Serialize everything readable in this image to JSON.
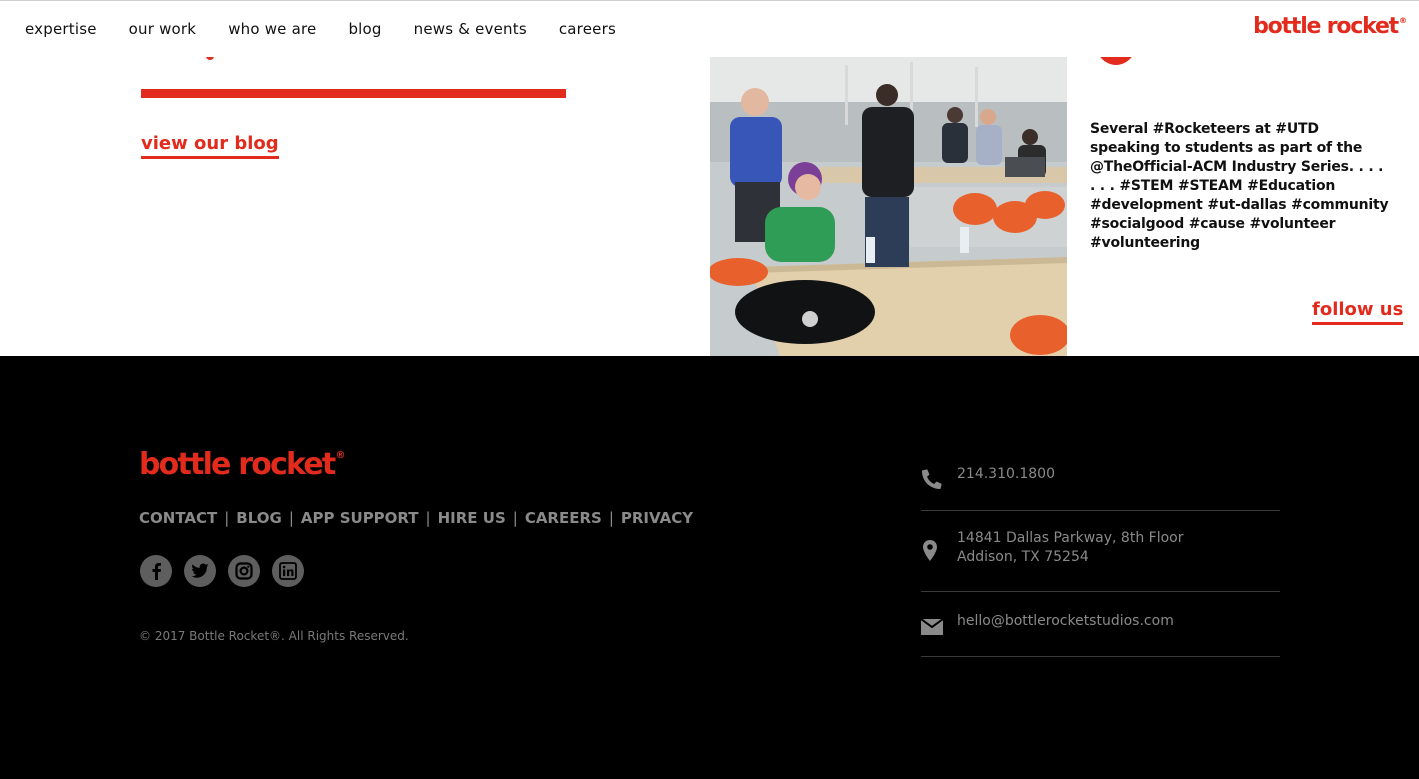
{
  "nav": {
    "items": [
      {
        "label": "expertise"
      },
      {
        "label": "our work"
      },
      {
        "label": "who we are"
      },
      {
        "label": "blog"
      },
      {
        "label": "news & events"
      },
      {
        "label": "careers"
      }
    ],
    "brand": "bottle rocket",
    "brand_mark": "®"
  },
  "content": {
    "view_blog": "view our blog",
    "instagram_caption": "Several #Rocketeers at #UTD speaking to students as part of the @TheOfficial-ACM Industry Series. . . . . . . #STEM #STEAM #Education #development #ut-dallas #community #socialgood #cause #volunteer #volunteering",
    "follow_us": "follow us"
  },
  "footer": {
    "brand": "bottle rocket",
    "brand_mark": "®",
    "links": [
      {
        "label": "CONTACT"
      },
      {
        "label": "BLOG"
      },
      {
        "label": "APP SUPPORT"
      },
      {
        "label": "HIRE US"
      },
      {
        "label": "CAREERS"
      },
      {
        "label": "PRIVACY"
      }
    ],
    "link_separator": "|",
    "socials": [
      "facebook-icon",
      "twitter-icon",
      "instagram-icon",
      "linkedin-icon"
    ],
    "copyright": "© 2017 Bottle Rocket®. All Rights Reserved.",
    "contact": {
      "phone": "214.310.1800",
      "address_line1": "14841 Dallas Parkway, 8th Floor",
      "address_line2": "Addison, TX 75254",
      "email": "hello@bottlerocketstudios.com"
    }
  },
  "colors": {
    "brand_red": "#e32b1d",
    "footer_bg": "#000000",
    "footer_text": "#8a8a8a"
  }
}
